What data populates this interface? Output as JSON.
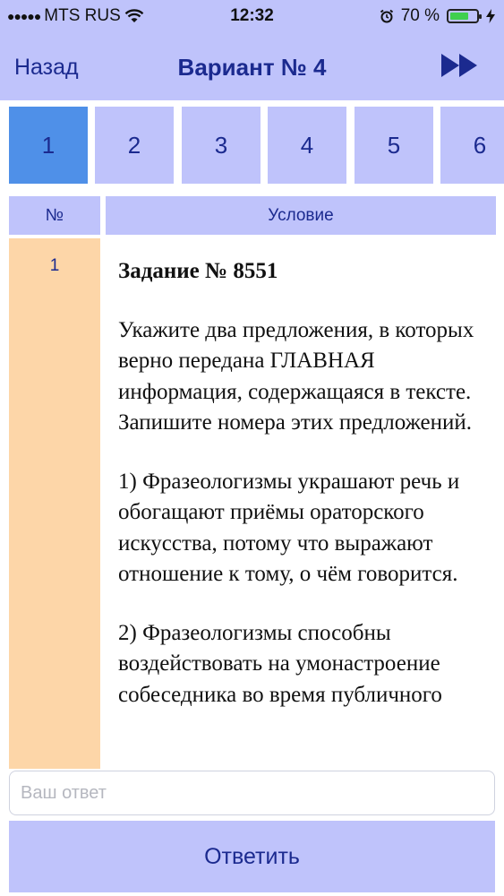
{
  "status_bar": {
    "carrier": "MTS RUS",
    "time": "12:32",
    "battery_percent": "70 %",
    "battery_level": 0.7
  },
  "nav": {
    "back_label": "Назад",
    "title": "Вариант № 4",
    "forward_icon": "fast-forward-icon"
  },
  "tabs": [
    "1",
    "2",
    "3",
    "4",
    "5",
    "6"
  ],
  "active_tab": "1",
  "table": {
    "col_num": "№",
    "col_condition": "Условие",
    "row_number": "1"
  },
  "task": {
    "title": "Задание № 8551",
    "prompt": "Укажите два предложения, в которых верно передана ГЛАВНАЯ информация, содержащаяся в тексте. Запишите номера этих предложений.",
    "option_1": "1) Фразеологизмы украшают речь и обогащают приёмы ораторского искусства, потому что выражают отношение к тому, о чём говорится.",
    "option_2": "2) Фразеологизмы способны воздействовать на умонастроение собеседника во время публичного"
  },
  "answer": {
    "placeholder": "Ваш ответ",
    "value": ""
  },
  "submit_label": "Ответить",
  "colors": {
    "header_bg": "#bfc3fb",
    "active_tab": "#4f90e8",
    "number_column": "#fdd6a8",
    "text_accent": "#1b2a8f"
  }
}
